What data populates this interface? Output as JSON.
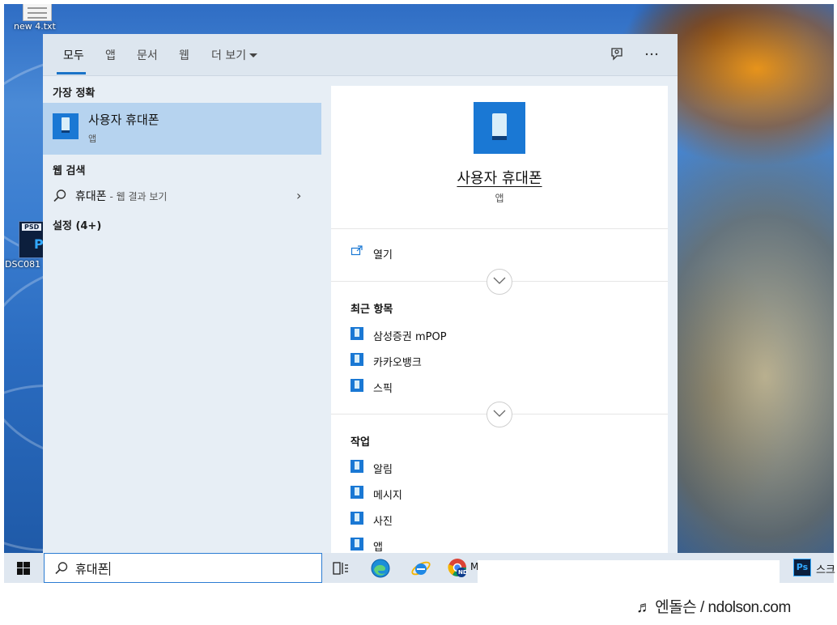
{
  "desktop": {
    "file_icon_label": "new 4.txt",
    "psd_icon_label": "DSC081",
    "psd_tag": "PSD",
    "psd_ps": "Ps"
  },
  "tabs": [
    {
      "label": "모두",
      "active": true
    },
    {
      "label": "앱"
    },
    {
      "label": "문서"
    },
    {
      "label": "웹"
    },
    {
      "label": "더 보기"
    }
  ],
  "top_icons": [
    "feedback-icon",
    "more-options-icon"
  ],
  "left": {
    "best_match_title": "가장 정확",
    "best_match": {
      "name": "사용자 휴대폰",
      "type": "앱",
      "icon": "phone-app-icon"
    },
    "web_search_title": "웹 검색",
    "web_query": "휴대폰",
    "web_query_suffix": " - 웹 결과 보기",
    "settings_title": "설정 (4+)"
  },
  "detail": {
    "name": "사용자 휴대폰",
    "type": "앱",
    "open_label": "열기",
    "recent_title": "최근 항목",
    "recent_items": [
      "삼성증권 mPOP",
      "카카오뱅크",
      "스픽"
    ],
    "tasks_title": "작업",
    "task_items": [
      "알림",
      "메시지",
      "사진",
      "앱"
    ]
  },
  "taskbar": {
    "search_value": "휴대폰",
    "icons": [
      "windows-start-icon",
      "task-view-icon",
      "edge-icon",
      "internet-explorer-icon",
      "chrome-profile-icon"
    ],
    "chrome_badge": "ND",
    "chrome_label": "M",
    "ps_label": "Ps",
    "ps_text": "스크"
  },
  "watermark": "♬ 엔돌슨 / ndolson.com",
  "colors": {
    "accent": "#1a78d4",
    "selected": "#b6d3ef",
    "panel": "#e7eef5"
  }
}
